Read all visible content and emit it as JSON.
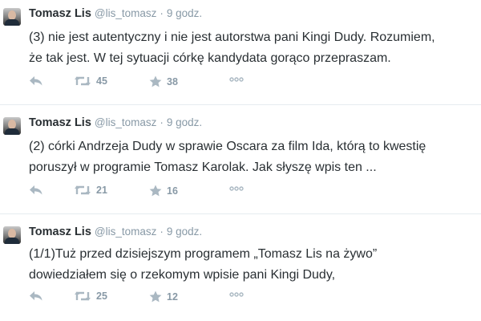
{
  "colors": {
    "name": "#292f33",
    "meta": "#8899a6",
    "icon": "#aab8c2",
    "divider": "#e6ecf0"
  },
  "icons": {
    "reply": "reply-icon",
    "retweet": "retweet-icon",
    "favorite": "star-icon",
    "more": "more-dots-icon"
  },
  "tweets": [
    {
      "name": "Tomasz Lis",
      "handle": "@lis_tomasz",
      "separator": "·",
      "time": "9 godz.",
      "line1": "(3) nie jest autentyczny i nie jest autorstwa pani Kingi Dudy. Rozumiem,",
      "line2": "że tak jest. W tej sytuacji córkę kandydata gorąco przepraszam.",
      "retweets": "45",
      "favorites": "38"
    },
    {
      "name": "Tomasz Lis",
      "handle": "@lis_tomasz",
      "separator": "·",
      "time": "9 godz.",
      "line1": "(2) córki Andrzeja Dudy w sprawie Oscara za film Ida, którą to kwestię",
      "line2": "poruszył w programie Tomasz Karolak. Jak słyszę wpis ten ...",
      "retweets": "21",
      "favorites": "16"
    },
    {
      "name": "Tomasz Lis",
      "handle": "@lis_tomasz",
      "separator": "·",
      "time": "9 godz.",
      "line1": "(1/1)Tuż przed dzisiejszym programem „Tomasz Lis na żywo”",
      "line2": "dowiedziałem się o rzekomym wpisie pani Kingi Dudy,",
      "retweets": "25",
      "favorites": "12"
    }
  ]
}
